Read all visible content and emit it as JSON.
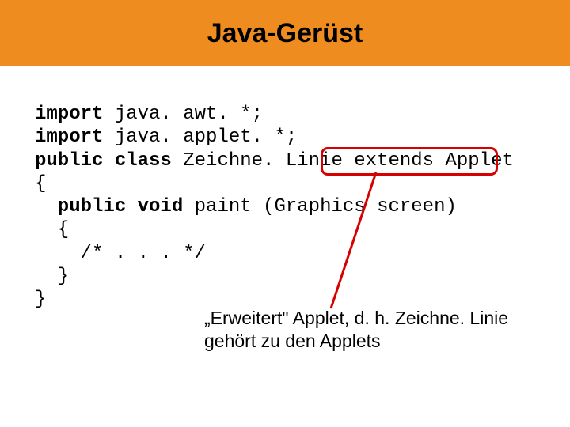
{
  "title": "Java-Gerüst",
  "code": {
    "l1a": "import",
    "l1b": " java. awt. *;",
    "l2a": "import",
    "l2b": " java. applet. *;",
    "l3a": "public class",
    "l3b": " Zeichne. Linie ",
    "l3c": "extends Applet",
    "l4": "{",
    "l5a": "  public void",
    "l5b": " paint (Graphics screen)",
    "l6": "  {",
    "l7": "    /* . . . */",
    "l8": "  }",
    "l9": "}"
  },
  "annotation": {
    "line1": "„Erweitert\" Applet, d. h. Zeichne. Linie",
    "line2": "gehört zu den Applets"
  }
}
